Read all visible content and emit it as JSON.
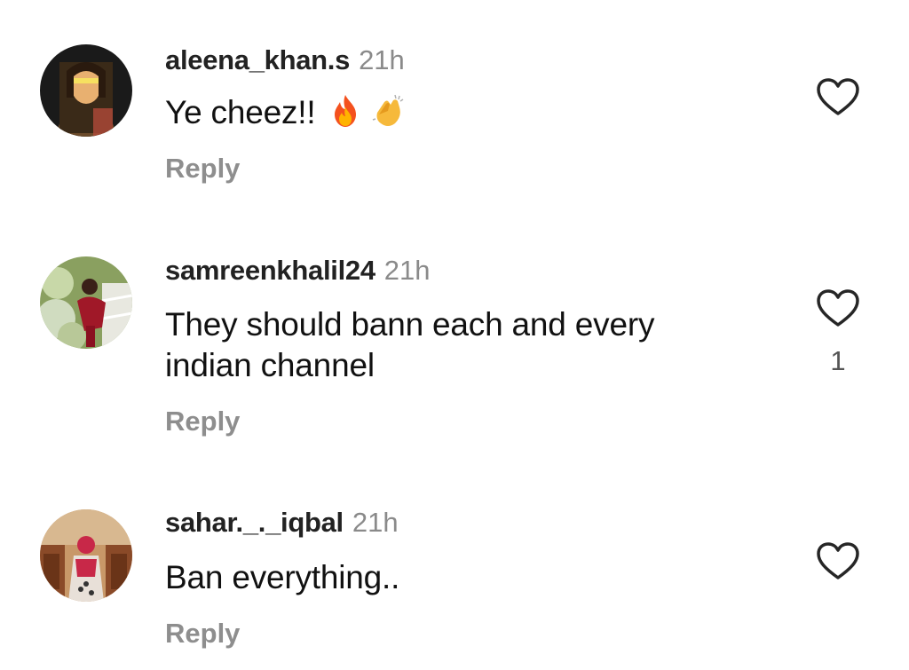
{
  "comments": [
    {
      "username": "aleena_khan.s",
      "time": "21h",
      "text": "Ye cheez!!",
      "emojis": [
        "fire-emoji",
        "clapping-hands-emoji"
      ],
      "reply_label": "Reply",
      "like_count": ""
    },
    {
      "username": "samreenkhalil24",
      "time": "21h",
      "text_line1": "They should bann each and every",
      "text_line2": "indian channel",
      "reply_label": "Reply",
      "like_count": "1"
    },
    {
      "username": "sahar._._iqbal",
      "time": "21h",
      "text": "Ban everything..",
      "reply_label": "Reply",
      "like_count": ""
    }
  ],
  "colors": {
    "username": "#222222",
    "timestamp": "#8a8a8a",
    "reply": "#8e8e8e",
    "heart_outline": "#262626"
  },
  "icons": [
    "heart-outline-icon",
    "avatar"
  ]
}
